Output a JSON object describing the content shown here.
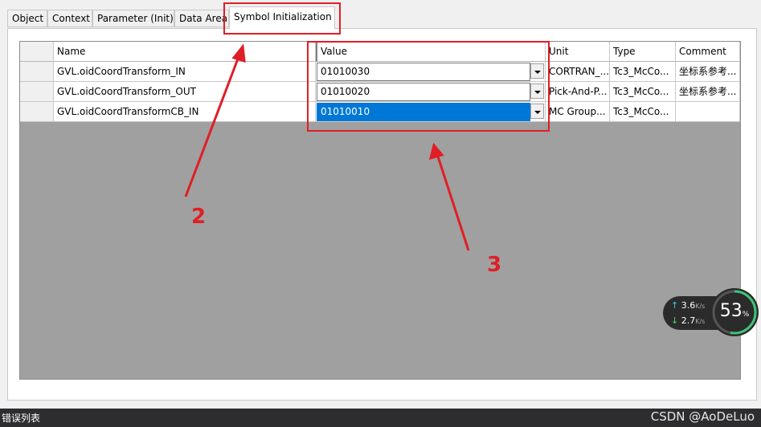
{
  "tabs": [
    "Object",
    "Context",
    "Parameter (Init)",
    "Data Area",
    "Symbol Initialization"
  ],
  "table": {
    "headers": [
      "Name",
      "Value",
      "Unit",
      "Type",
      "Comment"
    ],
    "rows": [
      {
        "name": "GVL.oidCoordTransform_IN",
        "value": "01010030",
        "unit": "CORTRAN_...",
        "type": "Tc3_McCo...",
        "comment": "坐标系参考..."
      },
      {
        "name": "GVL.oidCoordTransform_OUT",
        "value": "01010020",
        "unit": "Pick-And-P...",
        "type": "Tc3_McCo...",
        "comment": "坐标系参考..."
      },
      {
        "name": "GVL.oidCoordTransformCB_IN",
        "value": "01010010",
        "unit": "MC Group...",
        "type": "Tc3_McCo...",
        "comment": ""
      }
    ]
  },
  "annotations": {
    "label_2": "2",
    "label_3": "3",
    "color": "#e01e26"
  },
  "speed": {
    "up": "3.6",
    "down": "2.7",
    "unit": "K/s",
    "percent": "53",
    "percent_unit": "%"
  },
  "status_bar": {
    "label": "错误列表",
    "watermark": "CSDN @AoDeLuo"
  }
}
